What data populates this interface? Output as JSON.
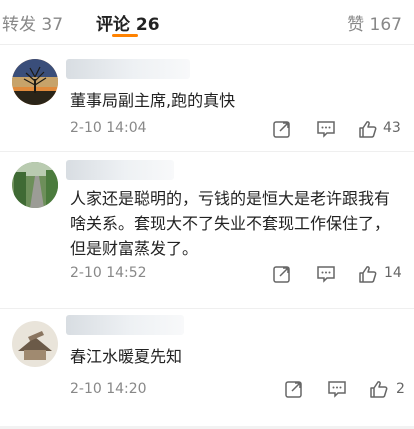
{
  "tabs": {
    "repost": "转发 37",
    "comments": "评论 26",
    "likes": "赞 167"
  },
  "comments": [
    {
      "text": "董事局副主席,跑的真快",
      "time": "2-10 14:04",
      "likes": "43"
    },
    {
      "text": "人家还是聪明的，亏钱的是恒大是老许跟我有啥关系。套现大不了失业不套现工作保住了，但是财富蒸发了。",
      "time": "2-10 14:52",
      "likes": "14"
    },
    {
      "text": "春江水暖夏先知",
      "time": "2-10 14:20",
      "likes": "2"
    }
  ],
  "colors": {
    "accent": "#ff8200",
    "muted": "#888888",
    "text": "#222222"
  },
  "icons": [
    "share-icon",
    "comment-icon",
    "like-icon"
  ]
}
